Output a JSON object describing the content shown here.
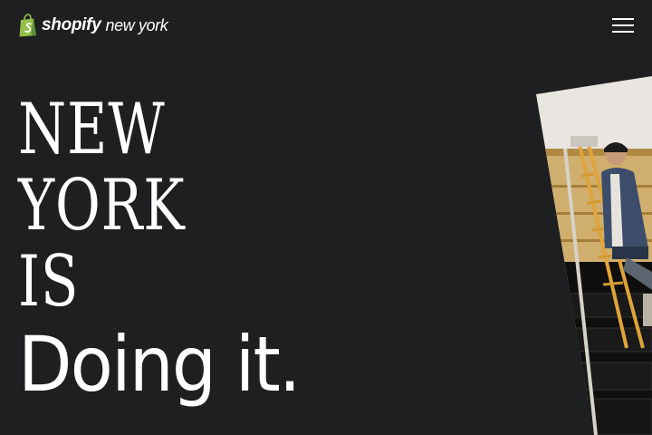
{
  "header": {
    "brand_name": "shopify",
    "brand_city": "new york",
    "menu_icon": "hamburger-icon"
  },
  "hero": {
    "lines": [
      "NEW",
      "YORK",
      "IS",
      "Doing it."
    ]
  },
  "photo": {
    "subject": "photo of a man sitting on a wooden ladder"
  },
  "colors": {
    "background": "#1d1f20",
    "text": "#ffffff",
    "brand_green": "#95bf47"
  }
}
